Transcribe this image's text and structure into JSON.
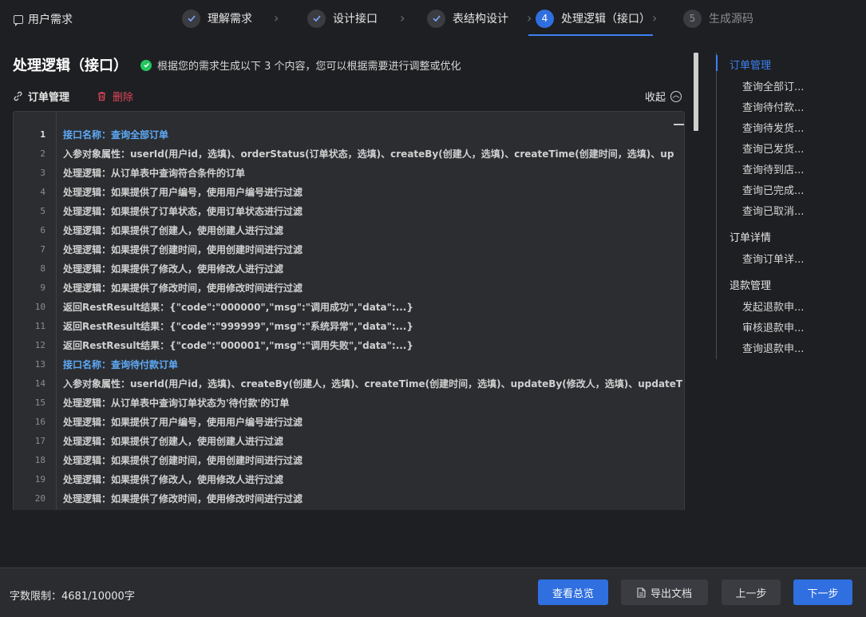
{
  "header": {
    "requirement_label": "用户需求",
    "steps": [
      {
        "num": "1",
        "label": "理解需求",
        "state": "done"
      },
      {
        "num": "2",
        "label": "设计接口",
        "state": "done"
      },
      {
        "num": "3",
        "label": "表结构设计",
        "state": "done"
      },
      {
        "num": "4",
        "label": "处理逻辑（接口）",
        "state": "active"
      },
      {
        "num": "5",
        "label": "生成源码",
        "state": "pending"
      }
    ]
  },
  "page": {
    "title": "处理逻辑（接口）",
    "status_message": "根据您的需求生成以下 3 个内容，您可以根据需要进行调整或优化"
  },
  "section": {
    "name": "订单管理",
    "delete_label": "删除",
    "collapse_label": "收起"
  },
  "editor": {
    "lines": [
      {
        "n": "1",
        "text": "接口名称：查询全部订单",
        "highlight": true
      },
      {
        "n": "2",
        "text": "入参对象属性：userId(用户id，选填)、orderStatus(订单状态，选填)、createBy(创建人，选填)、createTime(创建时间，选填)、up",
        "highlight": false
      },
      {
        "n": "3",
        "text": "处理逻辑：从订单表中查询符合条件的订单",
        "highlight": false
      },
      {
        "n": "4",
        "text": "处理逻辑：如果提供了用户编号，使用用户编号进行过滤",
        "highlight": false
      },
      {
        "n": "5",
        "text": "处理逻辑：如果提供了订单状态，使用订单状态进行过滤",
        "highlight": false
      },
      {
        "n": "6",
        "text": "处理逻辑：如果提供了创建人，使用创建人进行过滤",
        "highlight": false
      },
      {
        "n": "7",
        "text": "处理逻辑：如果提供了创建时间，使用创建时间进行过滤",
        "highlight": false
      },
      {
        "n": "8",
        "text": "处理逻辑：如果提供了修改人，使用修改人进行过滤",
        "highlight": false
      },
      {
        "n": "9",
        "text": "处理逻辑：如果提供了修改时间，使用修改时间进行过滤",
        "highlight": false
      },
      {
        "n": "10",
        "text": "返回RestResult结果：{\"code\":\"000000\",\"msg\":\"调用成功\",\"data\":...}",
        "highlight": false
      },
      {
        "n": "11",
        "text": "返回RestResult结果：{\"code\":\"999999\",\"msg\":\"系统异常\",\"data\":...}",
        "highlight": false
      },
      {
        "n": "12",
        "text": "返回RestResult结果：{\"code\":\"000001\",\"msg\":\"调用失败\",\"data\":...}",
        "highlight": false
      },
      {
        "n": "13",
        "text": "接口名称：查询待付款订单",
        "highlight": true
      },
      {
        "n": "14",
        "text": "入参对象属性：userId(用户id，选填)、createBy(创建人，选填)、createTime(创建时间，选填)、updateBy(修改人，选填)、updateT",
        "highlight": false
      },
      {
        "n": "15",
        "text": "处理逻辑：从订单表中查询订单状态为'待付款'的订单",
        "highlight": false
      },
      {
        "n": "16",
        "text": "处理逻辑：如果提供了用户编号，使用用户编号进行过滤",
        "highlight": false
      },
      {
        "n": "17",
        "text": "处理逻辑：如果提供了创建人，使用创建人进行过滤",
        "highlight": false
      },
      {
        "n": "18",
        "text": "处理逻辑：如果提供了创建时间，使用创建时间进行过滤",
        "highlight": false
      },
      {
        "n": "19",
        "text": "处理逻辑：如果提供了修改人，使用修改人进行过滤",
        "highlight": false
      },
      {
        "n": "20",
        "text": "处理逻辑：如果提供了修改时间，使用修改时间进行过滤",
        "highlight": false
      }
    ]
  },
  "toc": {
    "groups": [
      {
        "label": "订单管理",
        "active": true,
        "items": [
          "查询全部订...",
          "查询待付款...",
          "查询待发货...",
          "查询已发货...",
          "查询待到店...",
          "查询已完成...",
          "查询已取消..."
        ]
      },
      {
        "label": "订单详情",
        "active": false,
        "items": [
          "查询订单详..."
        ]
      },
      {
        "label": "退款管理",
        "active": false,
        "items": [
          "发起退款申...",
          "审核退款申...",
          "查询退款申..."
        ]
      }
    ]
  },
  "footer": {
    "word_limit": "字数限制：4681/10000字",
    "view_overview": "查看总览",
    "export_doc": "导出文档",
    "prev": "上一步",
    "next": "下一步"
  },
  "colors": {
    "accent": "#2f6fe0",
    "highlight_text": "#5eaaf7",
    "danger": "#e0475b",
    "success": "#22c55e"
  }
}
